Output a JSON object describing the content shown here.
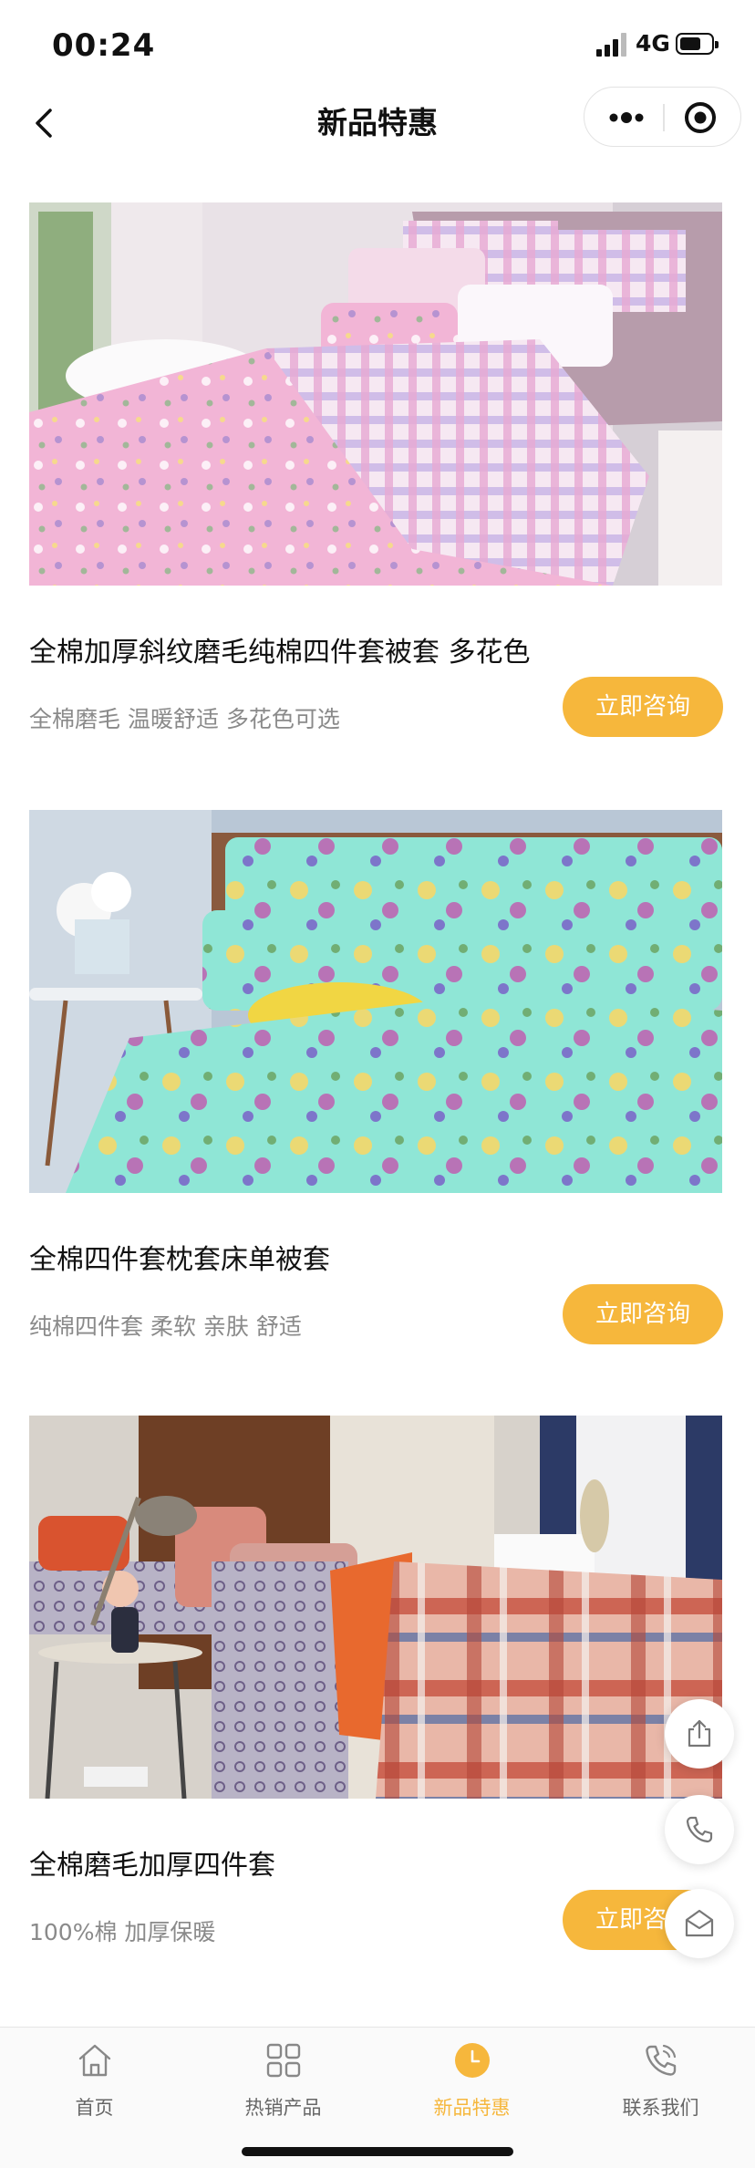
{
  "status_bar": {
    "time": "00:24",
    "network": "4G"
  },
  "nav": {
    "title": "新品特惠"
  },
  "products": [
    {
      "title": "全棉加厚斜纹磨毛纯棉四件套被套 多花色",
      "desc": "全棉磨毛 温暖舒适 多花色可选",
      "button": "立即咨询",
      "image": "pink-floral-bedding-photo"
    },
    {
      "title": "全棉四件套枕套床单被套",
      "desc": "纯棉四件套 柔软 亲肤 舒适",
      "button": "立即咨询",
      "image": "mint-floral-bedding-photo"
    },
    {
      "title": "全棉磨毛加厚四件套",
      "desc": "100%棉 加厚保暖",
      "button": "立即咨询",
      "image": "plaid-bedding-photo"
    }
  ],
  "float_buttons": [
    "share-icon",
    "phone-icon",
    "message-icon"
  ],
  "tabs": [
    {
      "label": "首页",
      "icon": "home-icon",
      "active": false
    },
    {
      "label": "热销产品",
      "icon": "grid-icon",
      "active": false
    },
    {
      "label": "新品特惠",
      "icon": "clock-icon",
      "active": true
    },
    {
      "label": "联系我们",
      "icon": "phone-icon",
      "active": false
    }
  ],
  "colors": {
    "accent": "#f6b73c",
    "text": "#111111",
    "muted": "#8a8a8a"
  }
}
